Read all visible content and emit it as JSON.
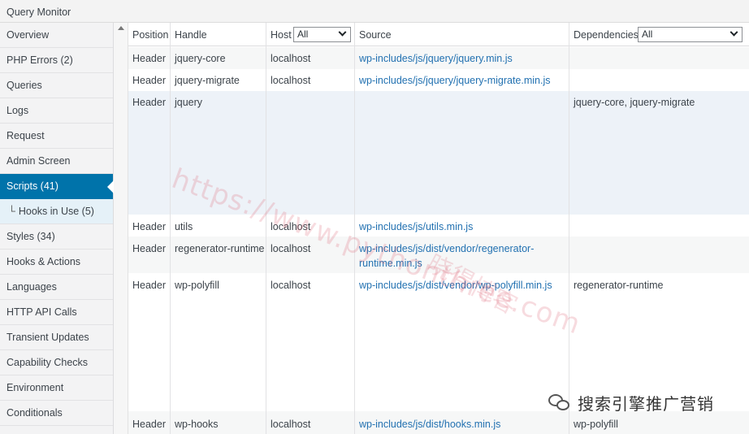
{
  "window": {
    "title": "Query Monitor"
  },
  "sidebar": {
    "items": [
      {
        "label": "Overview"
      },
      {
        "label": "PHP Errors (2)"
      },
      {
        "label": "Queries"
      },
      {
        "label": "Logs"
      },
      {
        "label": "Request"
      },
      {
        "label": "Admin Screen"
      },
      {
        "label": "Scripts (41)",
        "active": true
      },
      {
        "label": "Hooks in Use (5)",
        "sub": true,
        "branch": "└"
      },
      {
        "label": "Styles (34)"
      },
      {
        "label": "Hooks & Actions"
      },
      {
        "label": "Languages"
      },
      {
        "label": "HTTP API Calls"
      },
      {
        "label": "Transient Updates"
      },
      {
        "label": "Capability Checks"
      },
      {
        "label": "Environment"
      },
      {
        "label": "Conditionals"
      }
    ]
  },
  "table": {
    "headers": {
      "position": "Position",
      "handle": "Handle",
      "host": "Host",
      "host_filter": "All",
      "source": "Source",
      "dependencies": "Dependencies",
      "dependencies_filter": "All"
    },
    "rows": [
      {
        "position": "Header",
        "handle": "jquery-core",
        "host": "localhost",
        "source": "wp-includes/js/jquery/jquery.min.js",
        "dependencies": ""
      },
      {
        "position": "Header",
        "handle": "jquery-migrate",
        "host": "localhost",
        "source": "wp-includes/js/jquery/jquery-migrate.min.js",
        "dependencies": ""
      },
      {
        "position": "Header",
        "handle": "jquery",
        "host": "",
        "source": "",
        "dependencies": "jquery-core, jquery-migrate"
      },
      {
        "position": "Header",
        "handle": "utils",
        "host": "localhost",
        "source": "wp-includes/js/utils.min.js",
        "dependencies": ""
      },
      {
        "position": "Header",
        "handle": "regenerator-runtime",
        "host": "localhost",
        "source_line1": "wp-includes/js/dist/vendor/regenerator-",
        "source_line2": "runtime.min.js",
        "dependencies": ""
      },
      {
        "position": "Header",
        "handle": "wp-polyfill",
        "host": "localhost",
        "source": "wp-includes/js/dist/vendor/wp-polyfill.min.js",
        "dependencies": "regenerator-runtime"
      },
      {
        "position": "Header",
        "handle": "wp-hooks",
        "host": "localhost",
        "source": "wp-includes/js/dist/hooks.min.js",
        "dependencies": "wp-polyfill"
      }
    ]
  },
  "overlay": {
    "watermark_url": "https://www.pythonthree.com",
    "watermark_cn": "晓得博客",
    "wechat_label": "搜索引擎推广营销"
  },
  "colors": {
    "accent": "#0073aa",
    "link": "#2271b1",
    "highlight_row": "#edf2f8"
  }
}
